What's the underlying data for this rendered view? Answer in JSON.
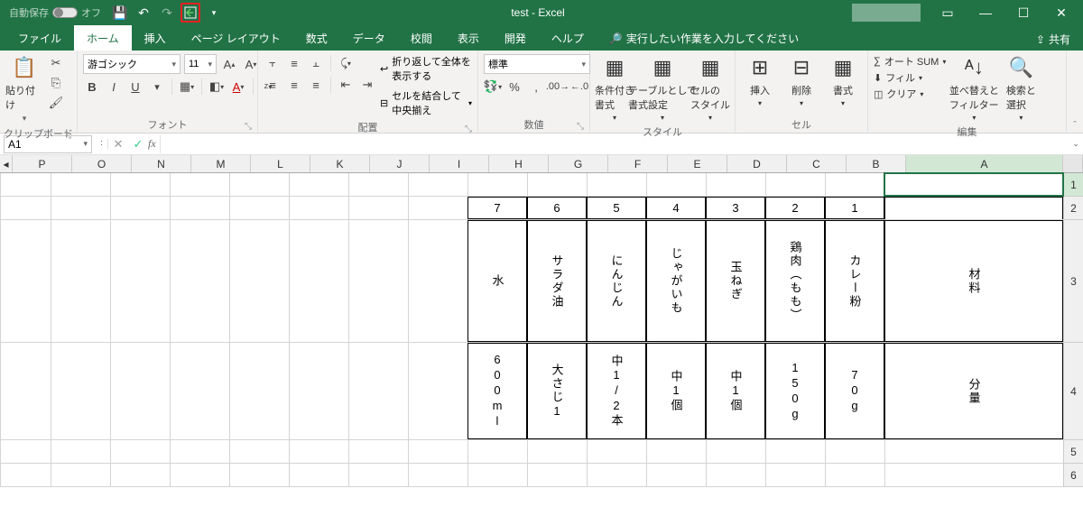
{
  "titlebar": {
    "autosave_label": "自動保存",
    "autosave_state": "オフ",
    "title": "test  -  Excel"
  },
  "tabs": {
    "file": "ファイル",
    "home": "ホーム",
    "insert": "挿入",
    "layout": "ページ レイアウト",
    "formulas": "数式",
    "data": "データ",
    "review": "校閲",
    "view": "表示",
    "developer": "開発",
    "help": "ヘルプ",
    "tell_me": "実行したい作業を入力してください",
    "share": "共有"
  },
  "ribbon": {
    "clipboard": {
      "label": "クリップボード",
      "paste": "貼り付け"
    },
    "font": {
      "label": "フォント",
      "name": "游ゴシック",
      "size": "11"
    },
    "alignment": {
      "label": "配置",
      "wrap": "折り返して全体を表示する",
      "merge": "セルを結合して中央揃え"
    },
    "number": {
      "label": "数値",
      "format": "標準"
    },
    "styles": {
      "label": "スタイル",
      "cond": "条件付き\n書式",
      "table": "テーブルとして\n書式設定",
      "cell": "セルの\nスタイル"
    },
    "cells": {
      "label": "セル",
      "insert": "挿入",
      "delete": "削除",
      "format": "書式"
    },
    "editing": {
      "label": "編集",
      "autosum": "オート SUM",
      "fill": "フィル",
      "clear": "クリア",
      "sort": "並べ替えと\nフィルター",
      "find": "検索と\n選択"
    }
  },
  "namebox": {
    "ref": "A1"
  },
  "columns": [
    "A",
    "B",
    "C",
    "D",
    "E",
    "F",
    "G",
    "H",
    "I",
    "J",
    "K",
    "L",
    "M",
    "N",
    "O",
    "P"
  ],
  "row_numbers": [
    "1",
    "2",
    "3",
    "4",
    "5",
    "6"
  ],
  "table": {
    "header_nums": [
      "1",
      "2",
      "3",
      "4",
      "5",
      "6",
      "7"
    ],
    "row1_label": "材料",
    "row1": [
      "カレー粉",
      "鶏肉（もも）",
      "玉ねぎ",
      "じゃがいも",
      "にんじん",
      "サラダ油",
      "水"
    ],
    "row2_label": "分量",
    "row2": [
      "70g",
      "150g",
      "中1個",
      "中1個",
      "中1/2本",
      "大さじ1",
      "600ml"
    ]
  }
}
